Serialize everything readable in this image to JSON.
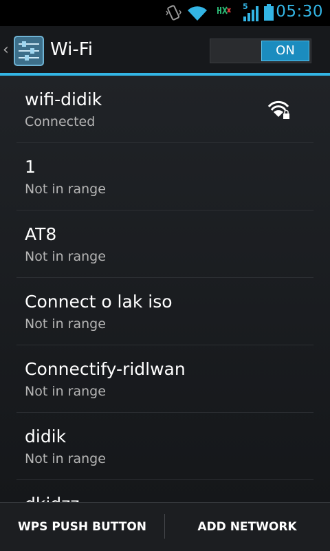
{
  "status_bar": {
    "time": "05:30",
    "network_label": "5",
    "icons": [
      "vibrate-icon",
      "wifi-icon",
      "data-activity-icon",
      "cell-signal-icon",
      "battery-icon"
    ]
  },
  "action_bar": {
    "title": "Wi-Fi",
    "toggle_label": "ON"
  },
  "networks": [
    {
      "ssid": "wifi-didik",
      "status": "Connected",
      "secured": true
    },
    {
      "ssid": "1",
      "status": "Not in range"
    },
    {
      "ssid": "AT8",
      "status": "Not in range"
    },
    {
      "ssid": "Connect o lak iso",
      "status": "Not in range"
    },
    {
      "ssid": "Connectify-ridlwan",
      "status": "Not in range"
    },
    {
      "ssid": "didik",
      "status": "Not in range"
    },
    {
      "ssid": "dkidzz",
      "status": ""
    }
  ],
  "bottom_bar": {
    "wps_label": "WPS PUSH BUTTON",
    "add_label": "ADD NETWORK"
  },
  "colors": {
    "accent": "#33b5e5",
    "background": "#111316",
    "toggle_on": "#1b8cbf"
  }
}
